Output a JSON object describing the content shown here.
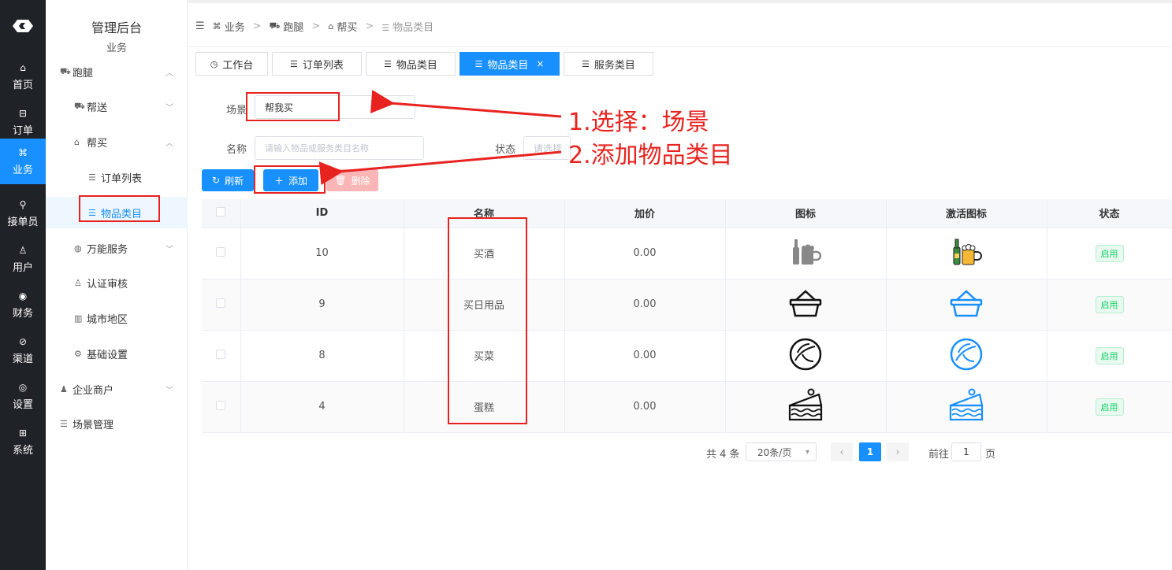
{
  "rail": {
    "items": [
      {
        "label": "首页",
        "icon": "home-icon",
        "glyph": "⌂"
      },
      {
        "label": "订单",
        "icon": "order-icon",
        "glyph": "⊟"
      },
      {
        "label": "业务",
        "icon": "business-icon",
        "glyph": "⌘"
      },
      {
        "label": "接单员",
        "icon": "rider-icon",
        "glyph": "⚲"
      },
      {
        "label": "用户",
        "icon": "user-icon",
        "glyph": "♙"
      },
      {
        "label": "财务",
        "icon": "finance-icon",
        "glyph": "◉"
      },
      {
        "label": "渠道",
        "icon": "channel-icon",
        "glyph": "⊘"
      },
      {
        "label": "设置",
        "icon": "settings-icon",
        "glyph": "◎"
      },
      {
        "label": "系统",
        "icon": "system-icon",
        "glyph": "⊞"
      }
    ]
  },
  "sidebar": {
    "title": "管理后台",
    "subtitle": "业务",
    "items": [
      {
        "label": "跑腿",
        "glyph": "⛟",
        "chev": "︿"
      },
      {
        "label": "帮送",
        "glyph": "⛟",
        "chev": "﹀"
      },
      {
        "label": "帮买",
        "glyph": "⌂",
        "chev": "︿"
      },
      {
        "label": "订单列表",
        "glyph": "☰"
      },
      {
        "label": "物品类目",
        "glyph": "☰"
      },
      {
        "label": "万能服务",
        "glyph": "◍",
        "chev": "﹀"
      },
      {
        "label": "认证审核",
        "glyph": "♙"
      },
      {
        "label": "城市地区",
        "glyph": "▥"
      },
      {
        "label": "基础设置",
        "glyph": "⚙"
      },
      {
        "label": "企业商户",
        "glyph": "♟",
        "chev": "﹀"
      },
      {
        "label": "场景管理",
        "glyph": "☰"
      }
    ]
  },
  "breadcrumb": {
    "items": [
      {
        "label": "业务",
        "glyph": "⌘"
      },
      {
        "label": "跑腿",
        "glyph": "⛟"
      },
      {
        "label": "帮买",
        "glyph": "⌂"
      },
      {
        "label": "物品类目",
        "glyph": "☰"
      }
    ],
    "separator": ">"
  },
  "tabs": [
    {
      "label": "工作台",
      "glyph": "◷"
    },
    {
      "label": "订单列表",
      "glyph": "☰"
    },
    {
      "label": "物品类目",
      "glyph": "☰"
    },
    {
      "label": "物品类目",
      "glyph": "☰",
      "active": true,
      "close": "×"
    },
    {
      "label": "服务类目",
      "glyph": "☰"
    }
  ],
  "filters": {
    "scene_label": "场景",
    "scene_value": "帮我买",
    "name_label": "名称",
    "name_placeholder": "请输入物品或服务类目名称",
    "status_label": "状态",
    "status_placeholder": "请选择"
  },
  "toolbar": {
    "refresh": "刷新",
    "add": "添加",
    "delete": "删除"
  },
  "table": {
    "columns": [
      "ID",
      "名称",
      "加价",
      "图标",
      "激活图标",
      "状态"
    ],
    "rows": [
      {
        "id": "10",
        "name": "买酒",
        "price": "0.00",
        "icon": "beer-icon",
        "status": "启用"
      },
      {
        "id": "9",
        "name": "买日用品",
        "price": "0.00",
        "icon": "basket-icon",
        "status": "启用"
      },
      {
        "id": "8",
        "name": "买菜",
        "price": "0.00",
        "icon": "cabbage-icon",
        "status": "启用"
      },
      {
        "id": "4",
        "name": "蛋糕",
        "price": "0.00",
        "icon": "cake-icon",
        "status": "启用"
      }
    ]
  },
  "pagination": {
    "total": "共 4 条",
    "page_size": "20条/页",
    "prev": "‹",
    "current": "1",
    "next": "›",
    "goto_label": "前往",
    "goto_value": "1",
    "goto_suffix": "页"
  },
  "annotations": {
    "step1": "1.选择：场景",
    "step2": "2.添加物品类目"
  },
  "colors": {
    "primary": "#1890ff",
    "rail_bg": "#1f2227",
    "annotation": "#e8231f",
    "active_icon": "#1890ff"
  }
}
